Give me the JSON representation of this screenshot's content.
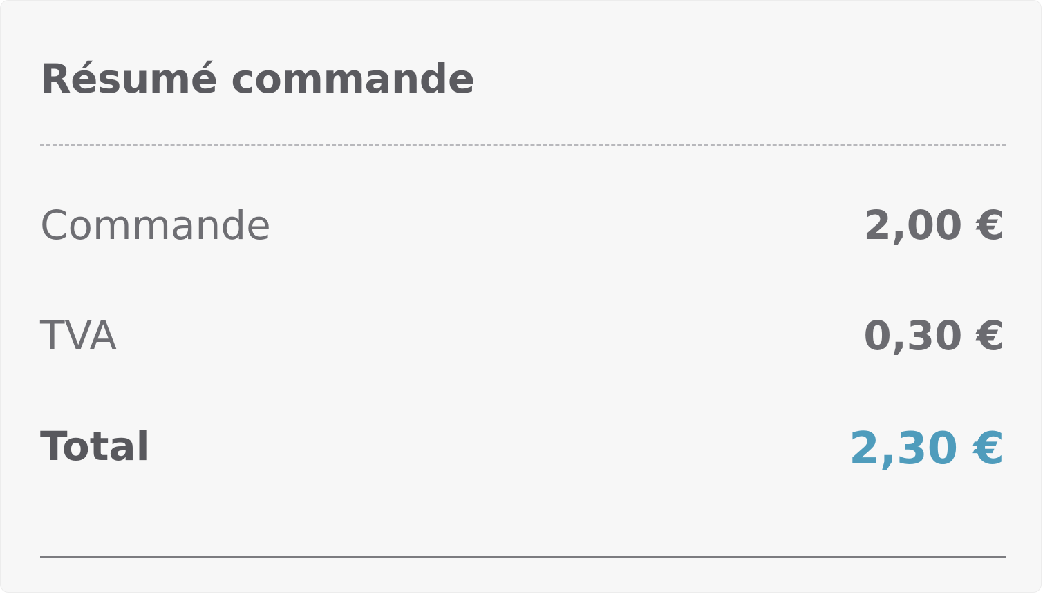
{
  "summary": {
    "title": "Résumé commande",
    "rows": [
      {
        "label": "Commande",
        "value": "2,00 €"
      },
      {
        "label": "TVA",
        "value": "0,30 €"
      }
    ],
    "total": {
      "label": "Total",
      "value": "2,30 €"
    }
  },
  "colors": {
    "background": "#f7f7f7",
    "text_dark": "#5b5b60",
    "text_muted": "#6e6e73",
    "total_accent": "#4f9cbc"
  }
}
